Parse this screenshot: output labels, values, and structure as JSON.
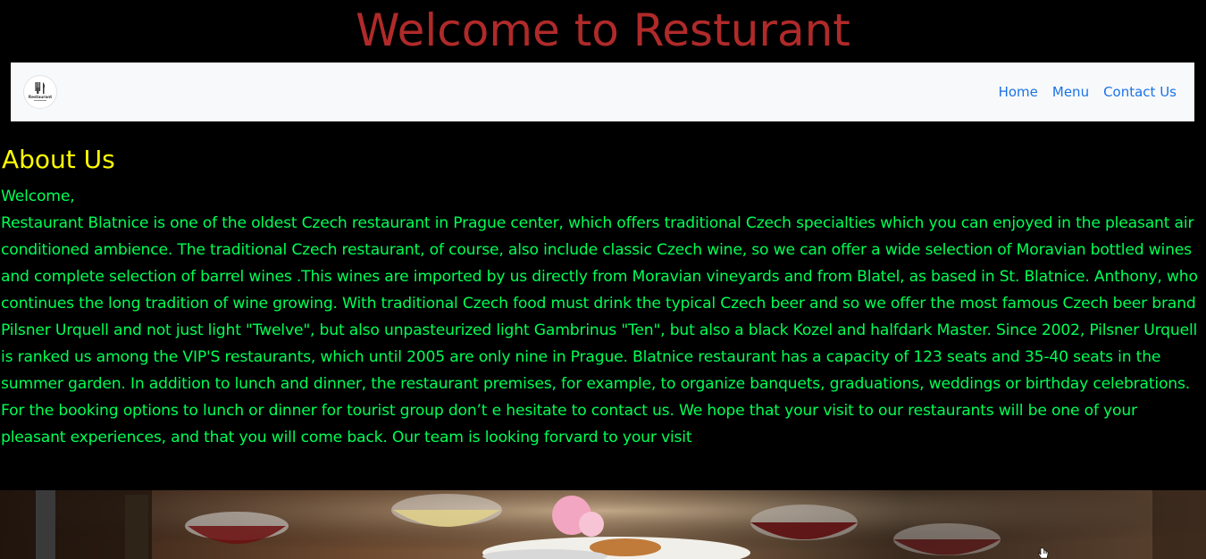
{
  "header": {
    "title": "Welcome to Resturant"
  },
  "navbar": {
    "logo_text": "Restaurant",
    "links": [
      {
        "label": "Home"
      },
      {
        "label": "Menu"
      },
      {
        "label": "Contact Us"
      }
    ]
  },
  "about": {
    "heading": "About Us",
    "greeting": "Welcome,",
    "body": "Restaurant Blatnice is one of the oldest Czech restaurant in Prague center, which offers traditional Czech specialties which you can enjoyed in the pleasant air conditioned ambience. The traditional Czech restaurant, of course, also include classic Czech wine, so we can offer a wide selection of Moravian bottled wines and complete selection of barrel wines .This wines are imported by us directly from Moravian vineyards and from Blatel, as based in St. Blatnice. Anthony, who continues the long tradition of wine growing. With traditional Czech food must drink the typical Czech beer and so we offer the most famous Czech beer brand Pilsner Urquell and not just light \"Twelve\", but also unpasteurized light Gambrinus \"Ten\", but also a black Kozel and halfdark Master. Since 2002, Pilsner Urquell is ranked us among the VIP'S restaurants, which until 2005 are only nine in Prague. Blatnice restaurant has a capacity of 123 seats and 35-40 seats in the summer garden. In addition to lunch and dinner, the restaurant premises, for example, to organize banquets, graduations, weddings or birthday celebrations. For the booking options to lunch or dinner for tourist group don’t e hesitate to contact us. We hope that your visit to our restaurants will be one of your pleasant experiences, and that you will come back. Our team is looking forvard to your visit"
  },
  "colors": {
    "background": "#000000",
    "title": "#b02a2a",
    "navbar_bg": "#f8f9fa",
    "nav_link": "#1a73e8",
    "heading": "#ffff00",
    "body_text": "#00ff55"
  },
  "icons": {
    "logo": "restaurant-logo-icon",
    "cursor": "hand-cursor-icon"
  }
}
